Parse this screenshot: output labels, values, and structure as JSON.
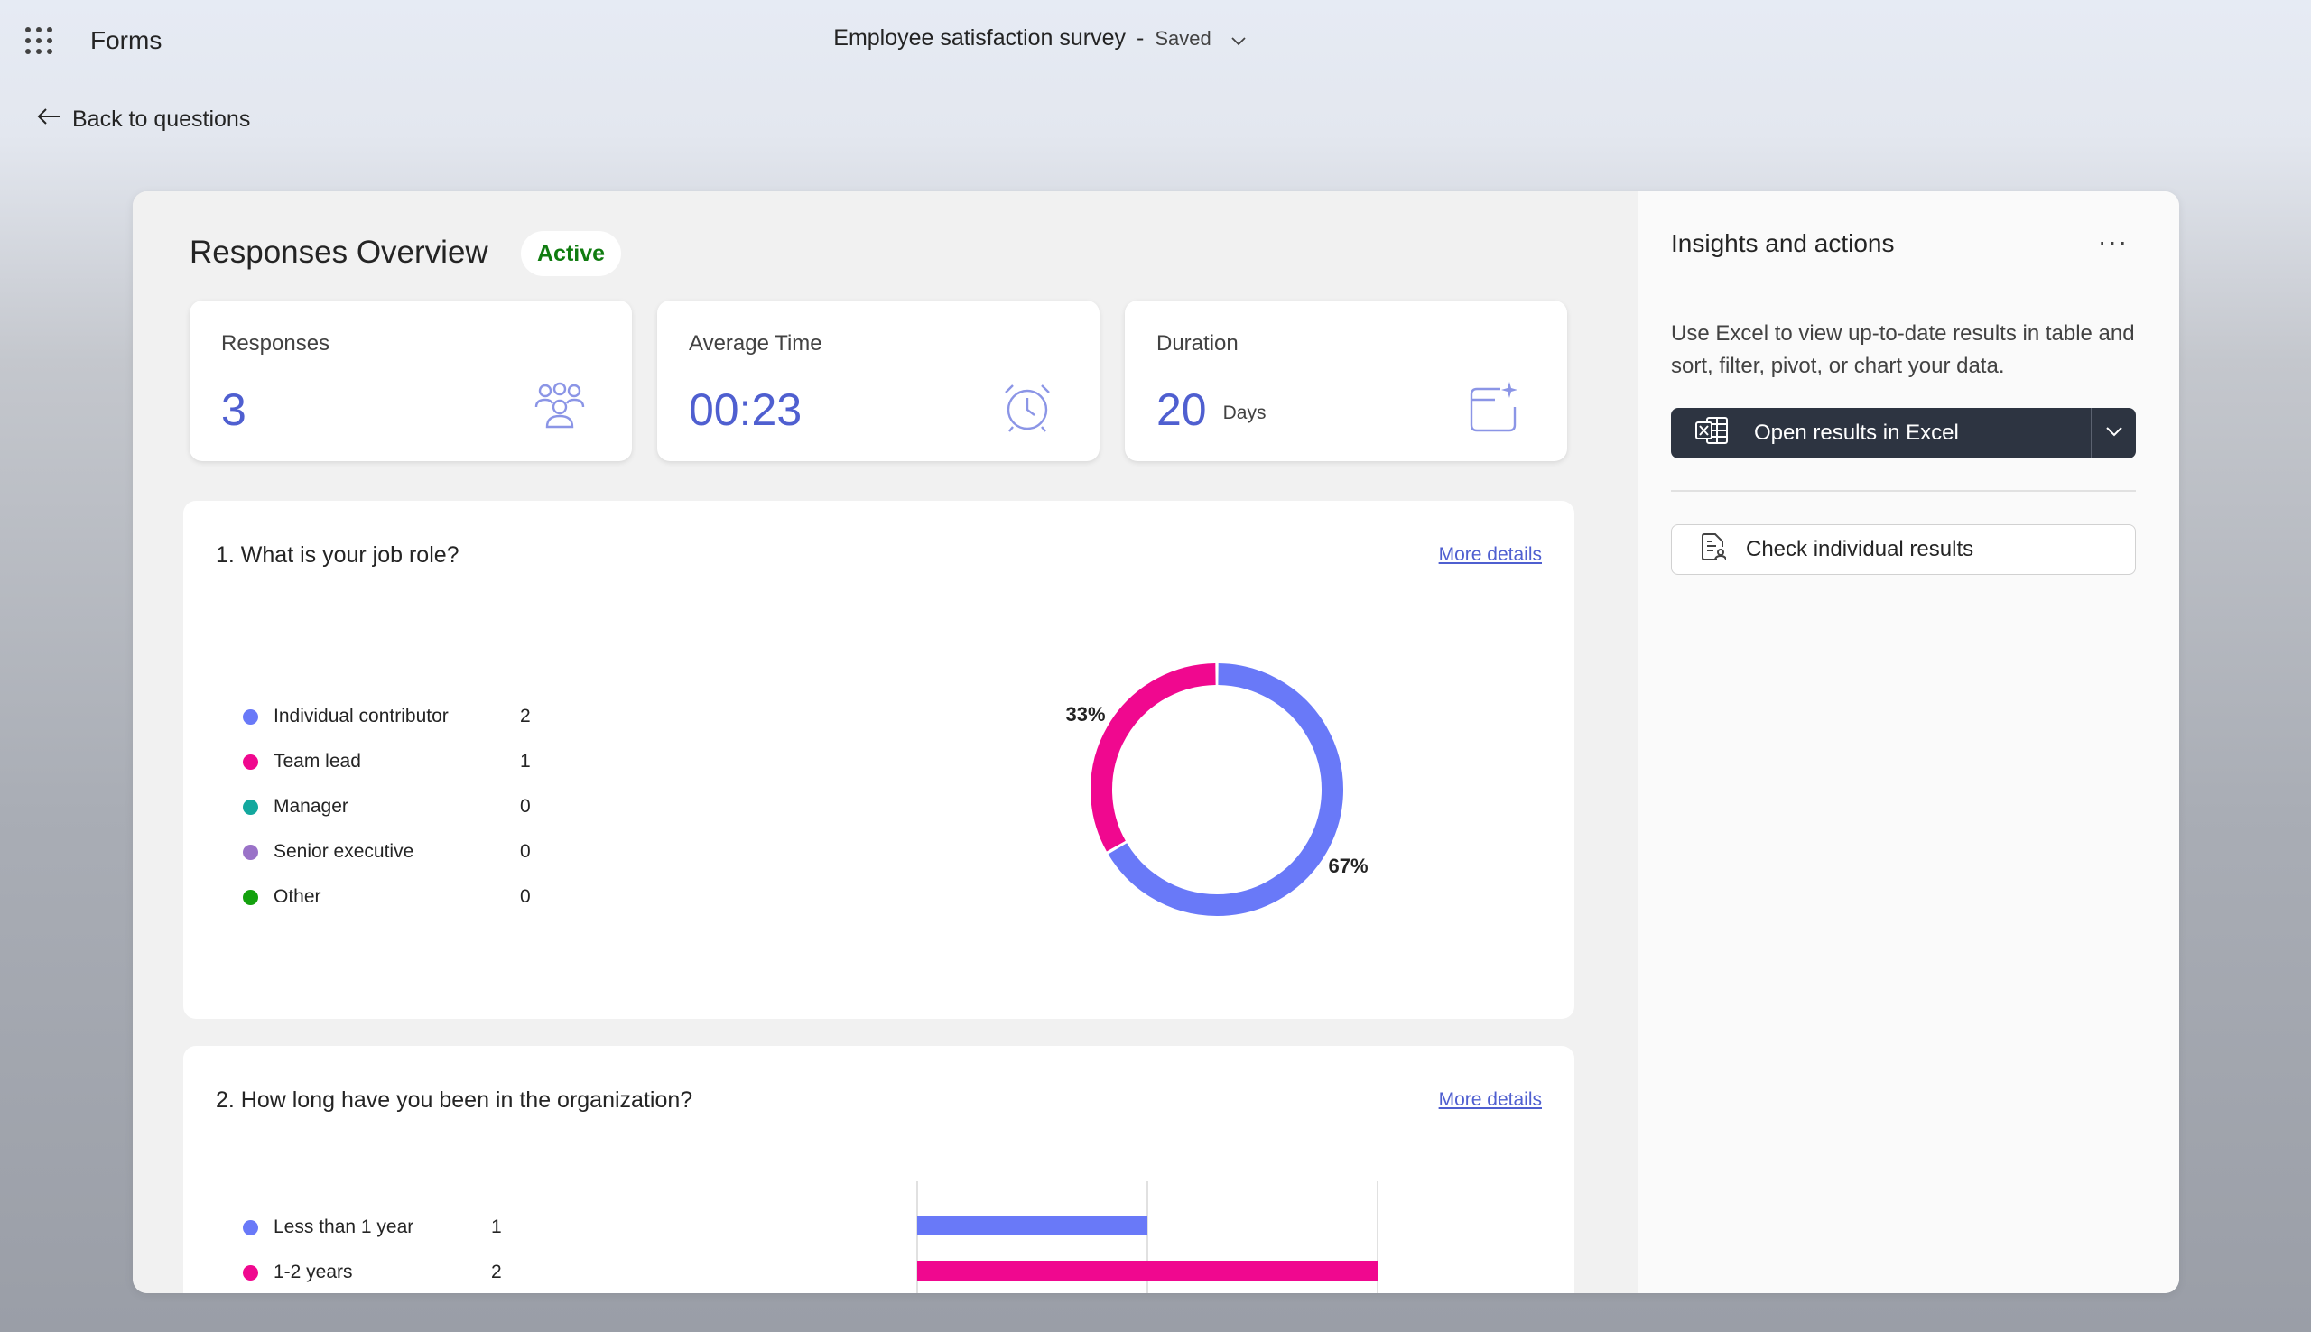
{
  "topbar": {
    "app_name": "Forms",
    "doc_title": "Employee satisfaction survey",
    "separator": "-",
    "save_status": "Saved"
  },
  "nav": {
    "back_label": "Back to questions"
  },
  "overview": {
    "title": "Responses Overview",
    "status": "Active",
    "stats": [
      {
        "label": "Responses",
        "value": "3",
        "unit": "",
        "icon": "people-icon"
      },
      {
        "label": "Average Time",
        "value": "00:23",
        "unit": "",
        "icon": "alarm-clock-icon"
      },
      {
        "label": "Duration",
        "value": "20",
        "unit": "Days",
        "icon": "calendar-sparkle-icon"
      }
    ]
  },
  "questions": [
    {
      "title": "1. What is your job role?",
      "more_label": "More details",
      "options": [
        {
          "label": "Individual contributor",
          "count": "2",
          "color": "#6979f8"
        },
        {
          "label": "Team lead",
          "count": "1",
          "color": "#f0088f"
        },
        {
          "label": "Manager",
          "count": "0",
          "color": "#13a89e"
        },
        {
          "label": "Senior executive",
          "count": "0",
          "color": "#9a72c8"
        },
        {
          "label": "Other",
          "count": "0",
          "color": "#13a10e"
        }
      ]
    },
    {
      "title": "2. How long have you been in the organization?",
      "more_label": "More details",
      "options": [
        {
          "label": "Less than 1 year",
          "count": "1",
          "color": "#6979f8"
        },
        {
          "label": "1-2 years",
          "count": "2",
          "color": "#f0088f"
        }
      ]
    }
  ],
  "chart_data": [
    {
      "type": "pie",
      "categories": [
        "Individual contributor",
        "Team lead",
        "Manager",
        "Senior executive",
        "Other"
      ],
      "values": [
        2,
        1,
        0,
        0,
        0
      ],
      "data_labels": [
        "67%",
        "33%"
      ],
      "colors": [
        "#6979f8",
        "#f0088f",
        "#13a89e",
        "#9a72c8",
        "#13a10e"
      ]
    },
    {
      "type": "bar",
      "orientation": "horizontal",
      "categories": [
        "Less than 1 year",
        "1-2 years"
      ],
      "values": [
        1,
        2
      ],
      "xlim": [
        0,
        2
      ],
      "grid": true,
      "colors": [
        "#6979f8",
        "#f0088f"
      ]
    }
  ],
  "insights": {
    "title": "Insights and actions",
    "more_label": "···",
    "description": "Use Excel to view up-to-date results in table and sort, filter, pivot, or chart your data.",
    "excel_button_label": "Open results in Excel",
    "check_button_label": "Check individual results"
  }
}
